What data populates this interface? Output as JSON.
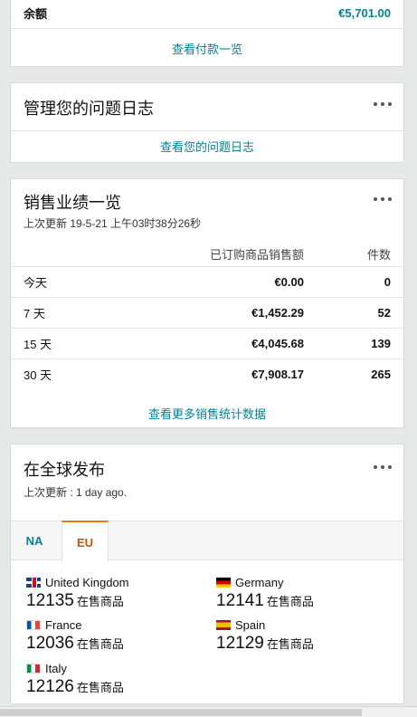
{
  "balance": {
    "label": "余额",
    "value": "€5,701.00",
    "link": "查看付款一览"
  },
  "issues": {
    "title": "管理您的问题日志",
    "link": "查看您的问题日志"
  },
  "sales": {
    "title": "销售业绩一览",
    "updated": "上次更新 19-5-21 上午03时38分26秒",
    "headers": {
      "amount": "已订购商品销售额",
      "count": "件数"
    },
    "rows": [
      {
        "period": "今天",
        "amount": "€0.00",
        "count": "0"
      },
      {
        "period": "7 天",
        "amount": "€1,452.29",
        "count": "52"
      },
      {
        "period": "15 天",
        "amount": "€4,045.68",
        "count": "139"
      },
      {
        "period": "30 天",
        "amount": "€7,908.17",
        "count": "265"
      }
    ],
    "link": "查看更多销售统计数据"
  },
  "global": {
    "title": "在全球发布",
    "updated": "上次更新 : 1 day ago.",
    "tabs": {
      "na": "NA",
      "eu": "EU"
    },
    "unit": "在售商品",
    "markets": [
      {
        "name": "United Kingdom",
        "count": "12135"
      },
      {
        "name": "Germany",
        "count": "12141"
      },
      {
        "name": "France",
        "count": "12036"
      },
      {
        "name": "Spain",
        "count": "12129"
      },
      {
        "name": "Italy",
        "count": "12126"
      }
    ]
  },
  "colors": {
    "link": "#008296",
    "active_tab": "#c45500",
    "tab_accent": "#e47911"
  }
}
